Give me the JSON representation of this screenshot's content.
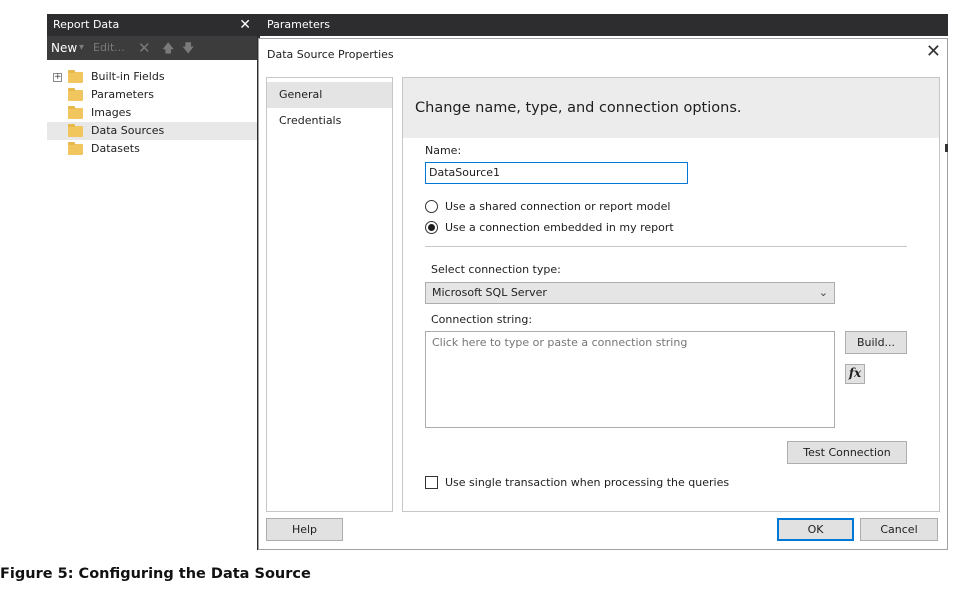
{
  "report_data": {
    "title": "Report Data",
    "toolbar": {
      "new": "New",
      "edit": "Edit..."
    },
    "tree": [
      {
        "label": "Built-in Fields",
        "expandable": true
      },
      {
        "label": "Parameters"
      },
      {
        "label": "Images"
      },
      {
        "label": "Data Sources",
        "selected": true
      },
      {
        "label": "Datasets"
      }
    ]
  },
  "parameters_header": "Parameters",
  "dialog": {
    "title": "Data Source Properties",
    "nav": [
      {
        "label": "General",
        "selected": true
      },
      {
        "label": "Credentials"
      }
    ],
    "heading": "Change name, type, and connection options.",
    "name_label": "Name:",
    "name_value": "DataSource1",
    "radio_shared": "Use a shared connection or report model",
    "radio_embedded": "Use a connection embedded in my report",
    "selected_radio": "embedded",
    "conn_type_label": "Select connection type:",
    "conn_type_value": "Microsoft SQL Server",
    "conn_string_label": "Connection string:",
    "conn_string_placeholder": "Click here to type or paste a connection string",
    "build_button": "Build...",
    "fx_button": "fx",
    "test_button": "Test Connection",
    "single_txn_label": "Use single transaction when processing the queries",
    "single_txn_checked": false,
    "help_button": "Help",
    "ok_button": "OK",
    "cancel_button": "Cancel"
  },
  "caption": "Figure 5: Configuring the Data Source",
  "colors": {
    "dark_header": "#2d2d30",
    "accent": "#0078d7",
    "folder": "#f2c65f"
  }
}
